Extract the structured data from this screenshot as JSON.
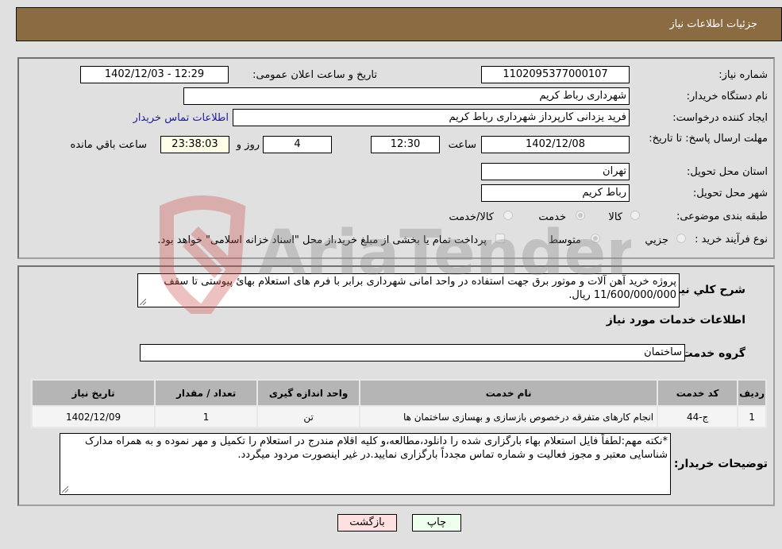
{
  "header": {
    "title": "جزئیات اطلاعات نیاز"
  },
  "form": {
    "need_number_label": "شماره نیاز:",
    "need_number": "1102095377000107",
    "announce_label": "تاریخ و ساعت اعلان عمومی:",
    "announce_value": "1402/12/03 - 12:29",
    "buyer_org_label": "نام دستگاه خریدار:",
    "buyer_org": "شهرداری رباط کریم",
    "creator_label": "ایجاد کننده درخواست:",
    "creator": "فرید یزدانی کارپرداز شهرداری رباط کریم",
    "contact_link": "اطلاعات تماس خریدار",
    "deadline_label": "مهلت ارسال پاسخ: تا تاریخ:",
    "deadline_date": "1402/12/08",
    "time_label": "ساعت",
    "deadline_time": "12:30",
    "days": "4",
    "days_label": "روز و",
    "remaining": "23:38:03",
    "remaining_label": "ساعت باقي مانده",
    "province_label": "استان محل تحویل:",
    "province": "تهران",
    "city_label": "شهر محل تحویل:",
    "city": "رباط کریم",
    "category_label": "طبقه بندی موضوعی:",
    "category_options": [
      {
        "label": "کالا",
        "selected": false
      },
      {
        "label": "خدمت",
        "selected": true
      },
      {
        "label": "کالا/خدمت",
        "selected": false
      }
    ],
    "process_label": "نوع فرآیند خرید :",
    "process_options": [
      {
        "label": "جزيي",
        "selected": false
      },
      {
        "label": "متوسط",
        "selected": true
      }
    ],
    "treasury_checkbox_label": "پرداخت تمام یا بخشی از مبلغ خرید،از محل \"اسناد خزانه اسلامی\" خواهد بود.",
    "treasury_checked": false
  },
  "details": {
    "description_label": "شرح كلي نياز:",
    "description": "پروژه خرید آهن آلات و موتور برق جهت استفاده در واحد امانی شهرداری برابر با فرم های استعلام بهائ پیوستی تا سقف 11/600/000/000 ریال.",
    "services_heading": "اطلاعات خدمات مورد نياز",
    "service_group_label": "گروه خدمت:",
    "service_group": "ساختمان",
    "table": {
      "headers": [
        "رديف",
        "کد خدمت",
        "نام خدمت",
        "واحد اندازه گیری",
        "تعداد / مقدار",
        "تاریخ نیاز"
      ],
      "rows": [
        [
          "1",
          "ج-44",
          "انجام کارهای متفرقه درخصوص بازسازی و بهسازی ساختمان ها",
          "تن",
          "1",
          "1402/12/09"
        ]
      ]
    },
    "buyer_notes_label": "توضيحات خريدار:",
    "buyer_notes": "*نکته مهم:لطفاً فایل استعلام بهاء بارگزاری شده را دانلود،مطالعه،و کلیه اقلام مندرج در استعلام را تکمیل و مهر نموده و به همراه مدارک شناسایی معتبر و مجوز فعالیت و شماره تماس مجدداً بارگزاری نمایید.در غیر اینصورت مردود میگردد."
  },
  "buttons": {
    "print": "چاپ",
    "back": "بازگشت"
  },
  "watermark": {
    "text": "AriaTender.neT"
  },
  "colors": {
    "header_bg": "#8b6b42",
    "print_bg": "#eeffee",
    "back_bg": "#ffe0e0",
    "link": "#1a1aa6"
  }
}
